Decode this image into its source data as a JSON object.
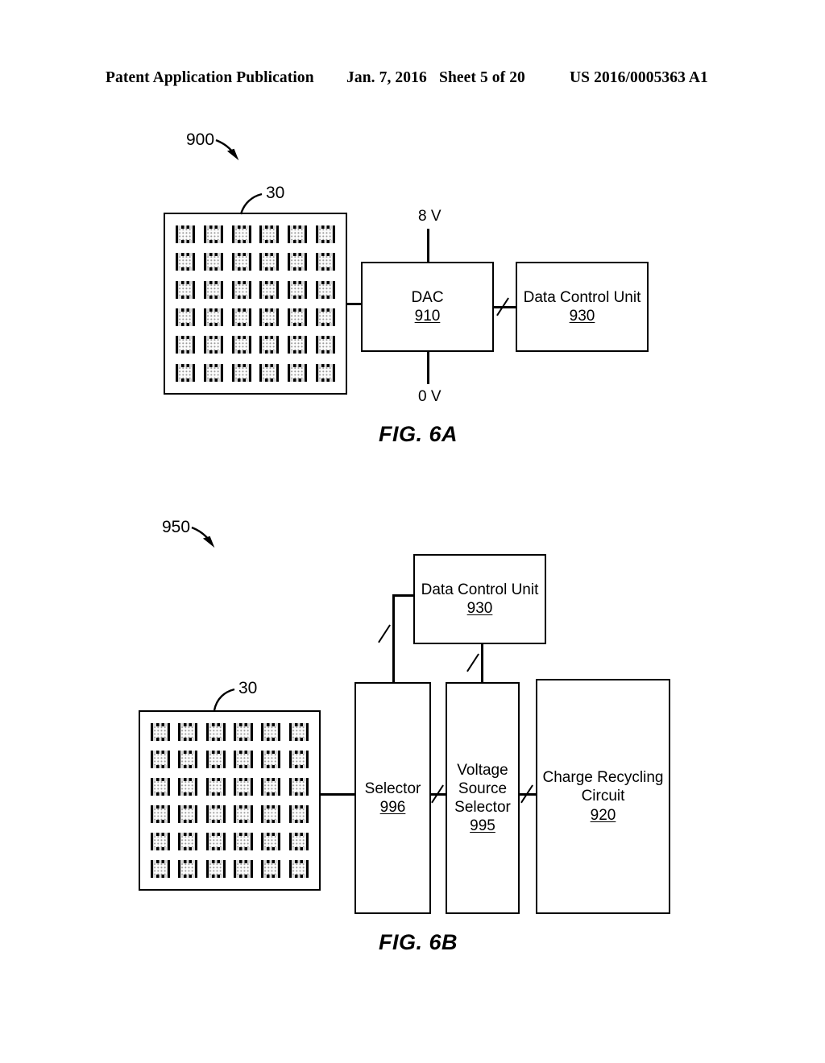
{
  "header": {
    "publication": "Patent Application Publication",
    "date": "Jan. 7, 2016",
    "sheet": "Sheet 5 of 20",
    "patent_number": "US 2016/0005363 A1"
  },
  "figures": [
    {
      "caption": "FIG. 6A",
      "system_callout": "900",
      "array": {
        "callout": "30",
        "rows": 6,
        "cols": 6
      },
      "rails": {
        "top": "8 V",
        "bottom": "0 V"
      },
      "boxes": [
        {
          "label": "DAC",
          "ref": "910"
        },
        {
          "label": "Data Control Unit",
          "ref": "930"
        }
      ]
    },
    {
      "caption": "FIG. 6B",
      "system_callout": "950",
      "array": {
        "callout": "30",
        "rows": 6,
        "cols": 6
      },
      "boxes": [
        {
          "label": "Data Control Unit",
          "ref": "930"
        },
        {
          "label": "Selector",
          "ref": "996"
        },
        {
          "label": "Voltage\nSource\nSelector",
          "ref": "995"
        },
        {
          "label": "Charge Recycling\nCircuit",
          "ref": "920"
        }
      ]
    }
  ],
  "colors": {
    "ink": "#000000",
    "paper": "#ffffff"
  }
}
